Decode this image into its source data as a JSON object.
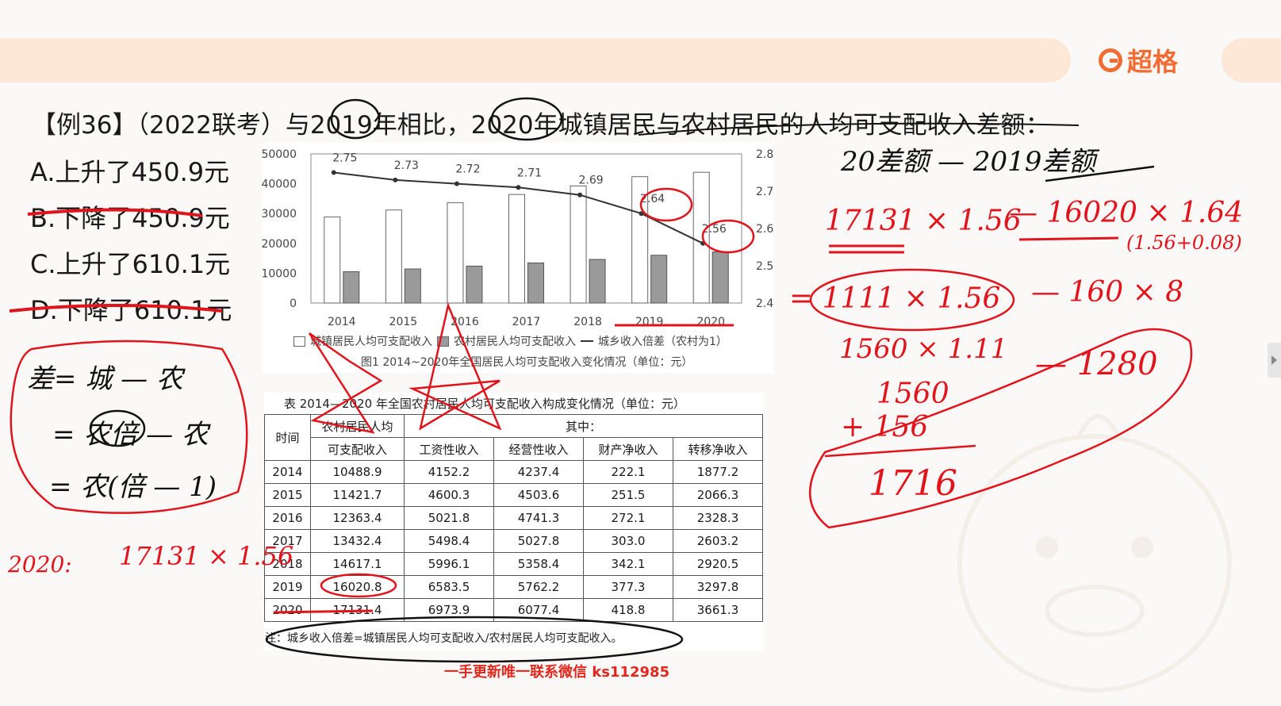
{
  "brand": {
    "logo_text": "超格",
    "accent": "#f26b32"
  },
  "question": {
    "text": "【例36】（2022联考）与2019年相比，2020年城镇居民与农村居民的人均可支配收入差额："
  },
  "options": [
    {
      "label": "A.上升了450.9元",
      "struck": false
    },
    {
      "label": "B.下降了450.9元",
      "struck": true
    },
    {
      "label": "C.上升了610.1元",
      "struck": false
    },
    {
      "label": "D.下降了610.1元",
      "struck": true
    }
  ],
  "chart_data": {
    "type": "bar",
    "caption": "图1  2014~2020年全国居民人均可支配收入变化情况（单位：元）",
    "categories": [
      "2014",
      "2015",
      "2016",
      "2017",
      "2018",
      "2019",
      "2020"
    ],
    "series": [
      {
        "name": "城镇居民人均可支配收入",
        "type": "bar",
        "color": "#ffffff",
        "values": [
          28844,
          31195,
          33616,
          36396,
          39251,
          42359,
          43834
        ]
      },
      {
        "name": "农村居民人均可支配收入",
        "type": "bar",
        "color": "#9a9a9a",
        "values": [
          10489,
          11422,
          12363,
          13432,
          14617,
          16021,
          17131
        ]
      },
      {
        "name": "城乡收入倍差（农村为1）",
        "type": "line",
        "axis": "right",
        "color": "#333333",
        "values": [
          2.75,
          2.73,
          2.72,
          2.71,
          2.69,
          2.64,
          2.56
        ]
      }
    ],
    "ylim": [
      0,
      50000
    ],
    "y_ticks": [
      "0",
      "10000",
      "20000",
      "30000",
      "40000",
      "50000"
    ],
    "y2lim": [
      2.4,
      2.8
    ],
    "y2_ticks": [
      "2.4",
      "2.5",
      "2.6",
      "2.7",
      "2.8"
    ],
    "point_labels": [
      "2.75",
      "2.73",
      "2.72",
      "2.71",
      "2.69",
      "2.64",
      "2.56"
    ],
    "legend_position": "bottom"
  },
  "table": {
    "title": "表  2014—2020 年全国农村居民人均可支配收入构成变化情况（单位：元）",
    "header_time": "时间",
    "header_total_1": "农村居民人均",
    "header_total_2": "可支配收入",
    "header_group": "其中：",
    "sub_headers": [
      "工资性收入",
      "经营性收入",
      "财产净收入",
      "转移净收入"
    ],
    "rows": [
      [
        "2014",
        "10488.9",
        "4152.2",
        "4237.4",
        "222.1",
        "1877.2"
      ],
      [
        "2015",
        "11421.7",
        "4600.3",
        "4503.6",
        "251.5",
        "2066.3"
      ],
      [
        "2016",
        "12363.4",
        "5021.8",
        "4741.3",
        "272.1",
        "2328.3"
      ],
      [
        "2017",
        "13432.4",
        "5498.4",
        "5027.8",
        "303.0",
        "2603.2"
      ],
      [
        "2018",
        "14617.1",
        "5996.1",
        "5358.4",
        "342.1",
        "2920.5"
      ],
      [
        "2019",
        "16020.8",
        "6583.5",
        "5762.2",
        "377.3",
        "3297.8"
      ],
      [
        "2020",
        "17131.4",
        "6973.9",
        "6077.4",
        "418.8",
        "3661.3"
      ]
    ],
    "note": "注：城乡收入倍差=城镇居民人均可支配收入/农村居民人均可支配收入。"
  },
  "annotations": {
    "right_title": "20差额 — 2019差额",
    "line1_a": "17131 × 1.56",
    "line1_b": "— 16020 × 1.64",
    "line1_c": "(1.56+0.08)",
    "line2_a": "= 1111 × 1.56",
    "line2_b": "— 160 × 8",
    "line3": "1560 × 1.11",
    "line3_b": "— 1280",
    "sum1": "1560",
    "sum2": "+ 156",
    "sum3": "1716",
    "left1": "差= 城 — 农",
    "left2": "= 农倍 — 农",
    "left3": "= 农(倍 — 1)",
    "left4_a": "2020:",
    "left4_b": "17131 × 1.56"
  },
  "footer": "一手更新唯一联系微信 ks112985"
}
